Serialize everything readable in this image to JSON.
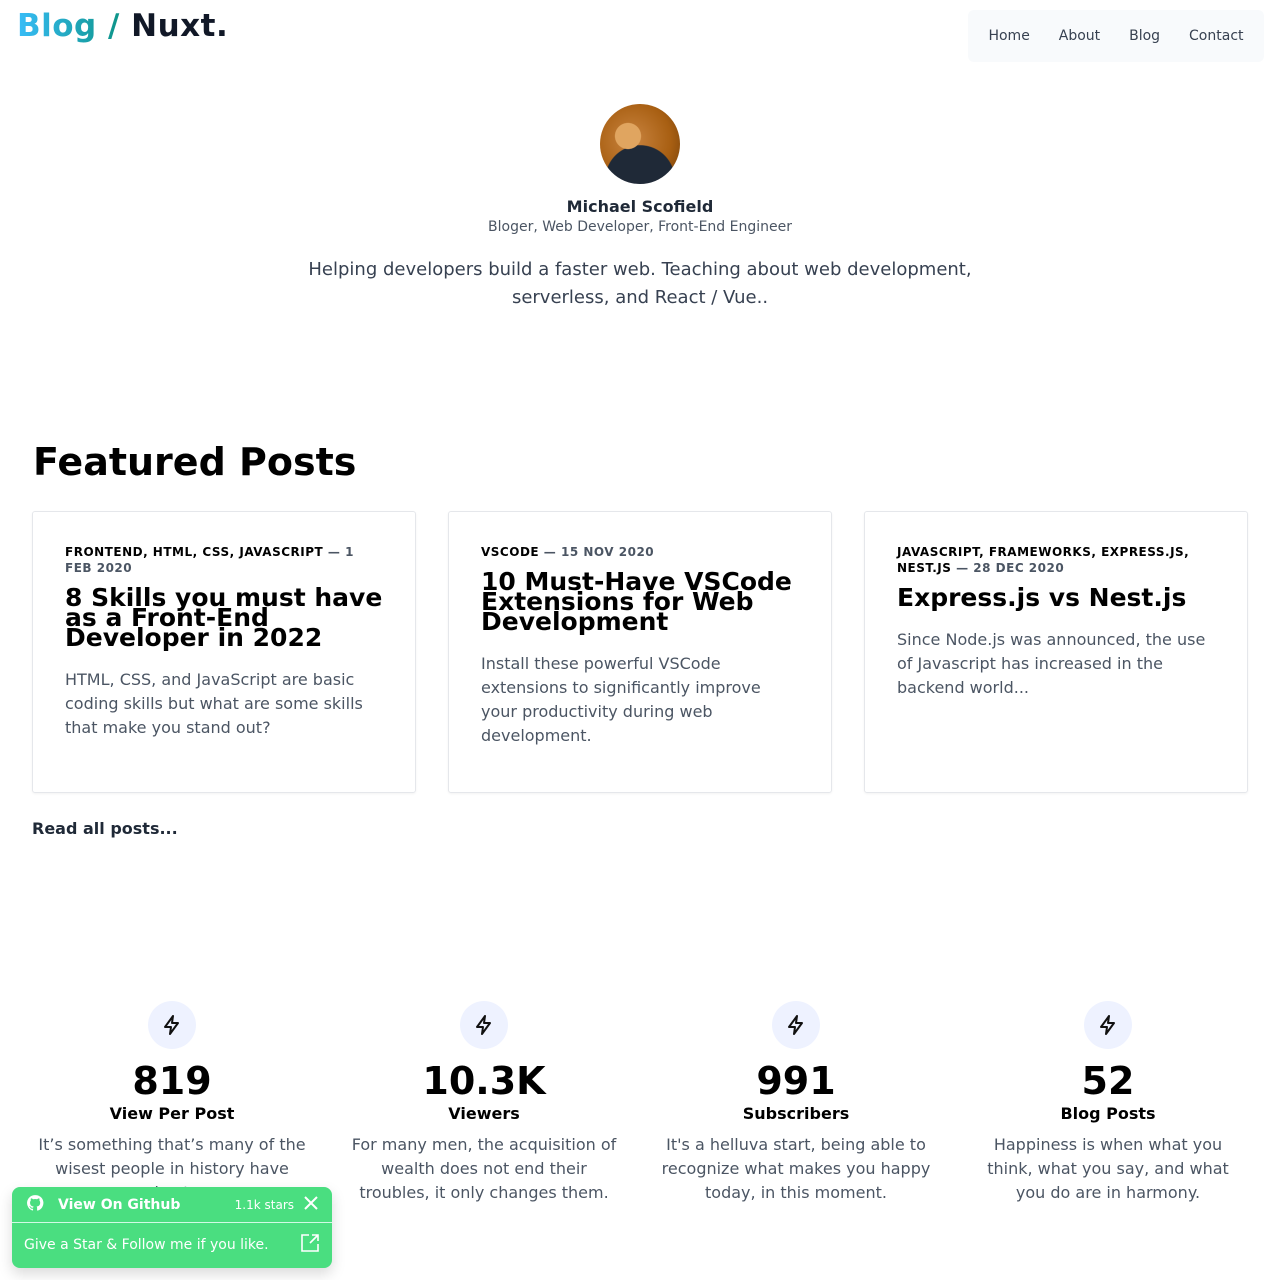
{
  "header": {
    "logo_blog": "Blog /",
    "logo_nuxt": "Nuxt.",
    "nav": [
      "Home",
      "About",
      "Blog",
      "Contact"
    ]
  },
  "profile": {
    "name": "Michael Scofield",
    "role": "Bloger, Web Developer, Front-End Engineer",
    "bio": "Helping developers build a faster web. Teaching about web development, serverless, and React / Vue.."
  },
  "featured": {
    "title": "Featured Posts",
    "read_all": "Read all posts...",
    "posts": [
      {
        "tags": "FRONTEND, HTML, CSS, JAVASCRIPT",
        "date": "— 1 FEB 2020",
        "title": "8 Skills you must have as a Front-End Developer in 2022",
        "desc": "HTML, CSS, and JavaScript are basic coding skills but what are some skills that make you stand out?"
      },
      {
        "tags": "VSCODE",
        "date": "— 15 NOV 2020",
        "title": "10 Must-Have VSCode Extensions for Web Development",
        "desc": "Install these powerful VSCode extensions to significantly improve your productivity during web development."
      },
      {
        "tags": "JAVASCRIPT, FRAMEWORKS, EXPRESS.JS, NEST.JS",
        "date": "— 28 DEC 2020",
        "title": "Express.js vs Nest.js",
        "desc": "Since Node.js was announced, the use of Javascript has increased in the backend world..."
      }
    ]
  },
  "stats": [
    {
      "icon": "lightning-icon",
      "value": "819",
      "label": "View Per Post",
      "desc": "It’s something that’s many of the wisest people in history have kept"
    },
    {
      "icon": "lightning-icon",
      "value": "10.3K",
      "label": "Viewers",
      "desc": "For many men, the acquisition of wealth does not end their troubles, it only changes them."
    },
    {
      "icon": "lightning-icon",
      "value": "991",
      "label": "Subscribers",
      "desc": "It's a helluva start, being able to recognize what makes you happy today, in this moment."
    },
    {
      "icon": "lightning-icon",
      "value": "52",
      "label": "Blog Posts",
      "desc": "Happiness is when what you think, what you say, and what you do are in harmony."
    }
  ],
  "github_banner": {
    "title": "View On Github",
    "stars": "1.1k stars",
    "message": "Give a Star & Follow me if you like.",
    "color": "#4ade80"
  }
}
